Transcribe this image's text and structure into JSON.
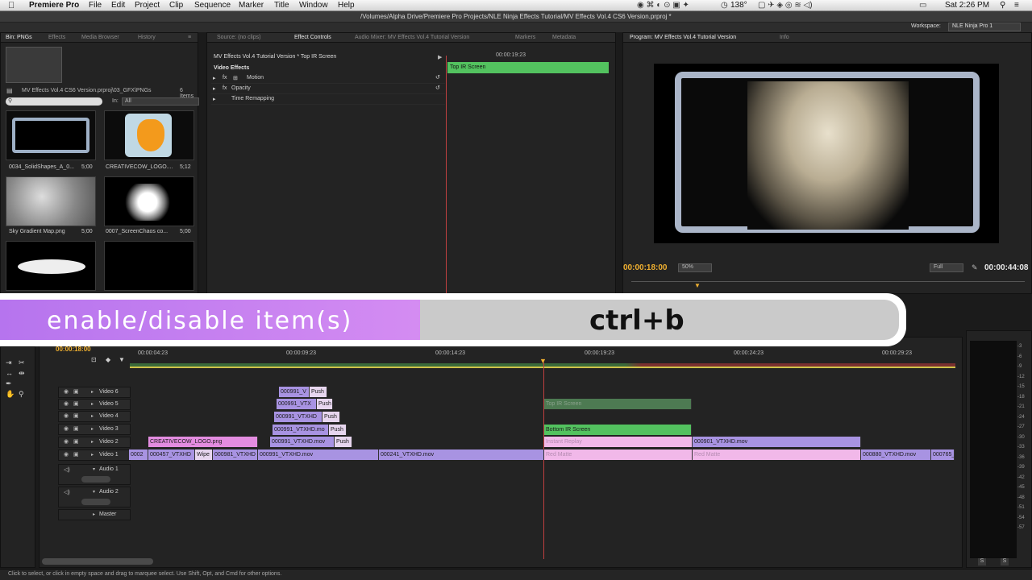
{
  "menubar": {
    "apple": "",
    "app_name": "Premiere Pro",
    "menus": [
      "File",
      "Edit",
      "Project",
      "Clip",
      "Sequence",
      "Marker",
      "Title",
      "Window",
      "Help"
    ],
    "status": {
      "temp": "138°",
      "clock": "Sat 2:26 PM"
    }
  },
  "path_title": "/Volumes/Alpha Drive/Premiere Pro Projects/NLE Ninja Effects Tutorial/MV Effects Vol.4 CS6 Version.prproj *",
  "workspace": {
    "label": "Workspace:",
    "value": "NLE Ninja Pro 1"
  },
  "project_panel": {
    "tabs": [
      "Bin: PNGs",
      "Effects",
      "Media Browser",
      "History"
    ],
    "bin_path": "MV Effects Vol.4 CS6 Version.prproj\\03_GFX\\PNGs",
    "item_count": "6 Items",
    "in_label": "In:",
    "in_value": "All",
    "items": [
      {
        "name": "0034_SolidShapes_A_0...",
        "dur": "5;00"
      },
      {
        "name": "CREATIVECOW_LOGO....",
        "dur": "5;12"
      },
      {
        "name": "Sky Gradient Map.png",
        "dur": "5;00"
      },
      {
        "name": "0007_ScreenChaos co...",
        "dur": "5;00"
      },
      {
        "name": "",
        "dur": ""
      },
      {
        "name": "",
        "dur": ""
      }
    ]
  },
  "effect_controls": {
    "tabs": [
      "Source: (no clips)",
      "Effect Controls",
      "Audio Mixer: MV Effects Vol.4 Tutorial Version",
      "Markers",
      "Metadata"
    ],
    "sequence_clip": "MV Effects Vol.4 Tutorial Version * Top IR Screen",
    "timecode": "00:00:19:23",
    "header": "Video Effects",
    "rows": [
      "Motion",
      "Opacity",
      "Time Remapping"
    ],
    "clip_bar": "Top IR Screen"
  },
  "program": {
    "tabs": [
      "Program: MV Effects Vol.4 Tutorial Version",
      "Info"
    ],
    "timecode": "00:00:18:00",
    "zoom": "50%",
    "quality": "Full",
    "duration": "00:00:44:08"
  },
  "overlay": {
    "action": "enable/disable item(s)",
    "shortcut": "ctrl+b"
  },
  "timeline": {
    "current_time": "00:00:18:00",
    "ruler": [
      "00:00:04:23",
      "00:00:09:23",
      "00:00:14:23",
      "00:00:19:23",
      "00:00:24:23",
      "00:00:29:23"
    ],
    "video_tracks": [
      "Video 6",
      "Video 5",
      "Video 4",
      "Video 3",
      "Video 2",
      "Video 1"
    ],
    "audio_tracks": [
      "Audio 1",
      "Audio 2",
      "Master"
    ],
    "clips": {
      "v6": [
        "000991_V",
        "Push"
      ],
      "v5": [
        "000991_VTX",
        "Push",
        "Top IR Screen"
      ],
      "v4": [
        "000991_VTXHD",
        "Push"
      ],
      "v3": [
        "000991_VTXHD.mo",
        "Push",
        "Bottom IR Screen"
      ],
      "v2": [
        "CREATIVECOW_LOGO.png",
        "000991_VTXHD.mov",
        "Push",
        "Instant Replay",
        "000901_VTXHD.mov"
      ],
      "v1": [
        "0002",
        "000457_VTXHD",
        "Wipe",
        "000981_VTXHD",
        "000991_VTXHD.mov",
        "000241_VTXHD.mov",
        "Red Matte",
        "Red Matte",
        "000880_VTXHD.mov",
        "000765_V"
      ]
    }
  },
  "meters": [
    "-3",
    "-6",
    "-9",
    "-12",
    "-15",
    "-18",
    "-21",
    "-24",
    "-27",
    "-30",
    "-33",
    "-36",
    "-39",
    "-42",
    "-45",
    "-48",
    "-51",
    "-54",
    "-57"
  ],
  "meter_footer": [
    "S",
    "S"
  ],
  "status_bar": "Click to select, or click in empty space and drag to marquee select. Use Shift, Opt, and Cmd for other options.",
  "colors": {
    "clip_purple": "#a893e2",
    "clip_pink": "#f1b8e9",
    "clip_green": "#53c25f",
    "overlay_purple": "#c77ff1",
    "playhead": "#ff9e3d"
  }
}
